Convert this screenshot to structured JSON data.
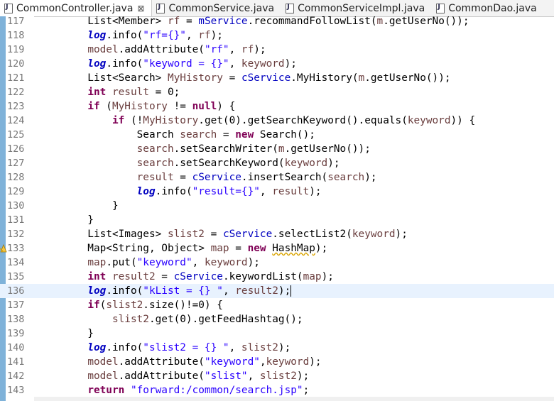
{
  "tabs": [
    {
      "label": "CommonController.java",
      "active": true,
      "close": "⊠"
    },
    {
      "label": "CommonService.java",
      "active": false
    },
    {
      "label": "CommonServiceImpl.java",
      "active": false
    },
    {
      "label": "CommonDao.java",
      "active": false
    }
  ],
  "lines": [
    {
      "n": "117",
      "t": [
        [
          "",
          "        List<Member> "
        ],
        [
          "var",
          "rf"
        ],
        [
          "",
          " = "
        ],
        [
          "fld",
          "mService"
        ],
        [
          "",
          ".recommandFollowList("
        ],
        [
          "var",
          "m"
        ],
        [
          "",
          ".getUserNo());"
        ]
      ]
    },
    {
      "n": "118",
      "t": [
        [
          "",
          "        "
        ],
        [
          "sfld",
          "log"
        ],
        [
          "",
          ".info("
        ],
        [
          "str",
          "\"rf={}\""
        ],
        [
          "",
          ", "
        ],
        [
          "var",
          "rf"
        ],
        [
          "",
          ");"
        ]
      ]
    },
    {
      "n": "119",
      "t": [
        [
          "",
          "        "
        ],
        [
          "var",
          "model"
        ],
        [
          "",
          ".addAttribute("
        ],
        [
          "str",
          "\"rf\""
        ],
        [
          "",
          ", "
        ],
        [
          "var",
          "rf"
        ],
        [
          "",
          ");"
        ]
      ]
    },
    {
      "n": "120",
      "t": [
        [
          "",
          "        "
        ],
        [
          "sfld",
          "log"
        ],
        [
          "",
          ".info("
        ],
        [
          "str",
          "\"keyword = {}\""
        ],
        [
          "",
          ", "
        ],
        [
          "var",
          "keyword"
        ],
        [
          "",
          ");"
        ]
      ]
    },
    {
      "n": "121",
      "t": [
        [
          "",
          "        List<Search> "
        ],
        [
          "var",
          "MyHistory"
        ],
        [
          "",
          " = "
        ],
        [
          "fld",
          "cService"
        ],
        [
          "",
          ".MyHistory("
        ],
        [
          "var",
          "m"
        ],
        [
          "",
          ".getUserNo());"
        ]
      ]
    },
    {
      "n": "122",
      "t": [
        [
          "",
          "        "
        ],
        [
          "kw",
          "int"
        ],
        [
          "",
          ""
        ],
        [
          "var",
          " result"
        ],
        [
          "",
          " = 0;"
        ]
      ]
    },
    {
      "n": "123",
      "t": [
        [
          "",
          "        "
        ],
        [
          "kw",
          "if"
        ],
        [
          "",
          " ("
        ],
        [
          "var",
          "MyHistory"
        ],
        [
          "",
          " != "
        ],
        [
          "kw",
          "null"
        ],
        [
          "",
          ") {"
        ]
      ]
    },
    {
      "n": "124",
      "t": [
        [
          "",
          "            "
        ],
        [
          "kw",
          "if"
        ],
        [
          "",
          " (!"
        ],
        [
          "var",
          "MyHistory"
        ],
        [
          "",
          ".get(0).getSearchKeyword().equals("
        ],
        [
          "var",
          "keyword"
        ],
        [
          "",
          ")) {"
        ]
      ]
    },
    {
      "n": "125",
      "t": [
        [
          "",
          "                Search "
        ],
        [
          "var",
          "search"
        ],
        [
          "",
          " = "
        ],
        [
          "kw",
          "new"
        ],
        [
          "",
          " Search();"
        ]
      ]
    },
    {
      "n": "126",
      "t": [
        [
          "",
          "                "
        ],
        [
          "var",
          "search"
        ],
        [
          "",
          ".setSearchWriter("
        ],
        [
          "var",
          "m"
        ],
        [
          "",
          ".getUserNo());"
        ]
      ]
    },
    {
      "n": "127",
      "t": [
        [
          "",
          "                "
        ],
        [
          "var",
          "search"
        ],
        [
          "",
          ".setSearchKeyword("
        ],
        [
          "var",
          "keyword"
        ],
        [
          "",
          ");"
        ]
      ]
    },
    {
      "n": "128",
      "t": [
        [
          "",
          "                "
        ],
        [
          "var",
          "result"
        ],
        [
          "",
          " = "
        ],
        [
          "fld",
          "cService"
        ],
        [
          "",
          ".insertSearch("
        ],
        [
          "var",
          "search"
        ],
        [
          "",
          ");"
        ]
      ]
    },
    {
      "n": "129",
      "t": [
        [
          "",
          "                "
        ],
        [
          "sfld",
          "log"
        ],
        [
          "",
          ".info("
        ],
        [
          "str",
          "\"result={}\""
        ],
        [
          "",
          ", "
        ],
        [
          "var",
          "result"
        ],
        [
          "",
          ");"
        ]
      ]
    },
    {
      "n": "130",
      "t": [
        [
          "",
          "            }"
        ]
      ]
    },
    {
      "n": "131",
      "t": [
        [
          "",
          "        }"
        ]
      ]
    },
    {
      "n": "132",
      "t": [
        [
          "",
          "        List<Images> "
        ],
        [
          "var",
          "slist2"
        ],
        [
          "",
          " = "
        ],
        [
          "fld",
          "cService"
        ],
        [
          "",
          ".selectList2("
        ],
        [
          "var",
          "keyword"
        ],
        [
          "",
          ");"
        ]
      ]
    },
    {
      "n": "133",
      "warn": true,
      "t": [
        [
          "",
          "        Map<String, Object> "
        ],
        [
          "var",
          "map"
        ],
        [
          "",
          " = "
        ],
        [
          "kw",
          "new"
        ],
        [
          "",
          " "
        ],
        [
          "squig",
          "HashMap"
        ],
        [
          "",
          ");"
        ]
      ]
    },
    {
      "n": "134",
      "t": [
        [
          "",
          "        "
        ],
        [
          "var",
          "map"
        ],
        [
          "",
          ".put("
        ],
        [
          "str",
          "\"keyword\""
        ],
        [
          "",
          ", "
        ],
        [
          "var",
          "keyword"
        ],
        [
          "",
          ");"
        ]
      ]
    },
    {
      "n": "135",
      "t": [
        [
          "",
          "        "
        ],
        [
          "kw",
          "int"
        ],
        [
          "",
          " "
        ],
        [
          "var",
          "result2"
        ],
        [
          "",
          " = "
        ],
        [
          "fld",
          "cService"
        ],
        [
          "",
          ".keywordList("
        ],
        [
          "var",
          "map"
        ],
        [
          "",
          ");"
        ]
      ]
    },
    {
      "n": "136",
      "hl": true,
      "caret": true,
      "t": [
        [
          "",
          "        "
        ],
        [
          "sfld",
          "log"
        ],
        [
          "",
          ".info("
        ],
        [
          "str",
          "\"kList = {} \""
        ],
        [
          "",
          ", "
        ],
        [
          "var",
          "result2"
        ],
        [
          "",
          ");"
        ]
      ]
    },
    {
      "n": "137",
      "t": [
        [
          "",
          "        "
        ],
        [
          "kw",
          "if"
        ],
        [
          "",
          "("
        ],
        [
          "var",
          "slist2"
        ],
        [
          "",
          ".size()!=0) {"
        ]
      ]
    },
    {
      "n": "138",
      "t": [
        [
          "",
          "            "
        ],
        [
          "var",
          "slist2"
        ],
        [
          "",
          ".get(0).getFeedHashtag();"
        ]
      ]
    },
    {
      "n": "139",
      "t": [
        [
          "",
          "        }"
        ]
      ]
    },
    {
      "n": "140",
      "t": [
        [
          "",
          "        "
        ],
        [
          "sfld",
          "log"
        ],
        [
          "",
          ".info("
        ],
        [
          "str",
          "\"slist2 = {} \""
        ],
        [
          "",
          ", "
        ],
        [
          "var",
          "slist2"
        ],
        [
          "",
          ");"
        ]
      ]
    },
    {
      "n": "141",
      "t": [
        [
          "",
          "        "
        ],
        [
          "var",
          "model"
        ],
        [
          "",
          ".addAttribute("
        ],
        [
          "str",
          "\"keyword\""
        ],
        [
          "",
          ","
        ],
        [
          "var",
          "keyword"
        ],
        [
          "",
          ");"
        ]
      ]
    },
    {
      "n": "142",
      "t": [
        [
          "",
          "        "
        ],
        [
          "var",
          "model"
        ],
        [
          "",
          ".addAttribute("
        ],
        [
          "str",
          "\"slist\""
        ],
        [
          "",
          ", "
        ],
        [
          "var",
          "slist2"
        ],
        [
          "",
          ");"
        ]
      ]
    },
    {
      "n": "143",
      "t": [
        [
          "",
          "        "
        ],
        [
          "kw",
          "return"
        ],
        [
          "",
          " "
        ],
        [
          "str",
          "\"forward:/common/search.jsp\""
        ],
        [
          "",
          ";"
        ]
      ]
    }
  ]
}
